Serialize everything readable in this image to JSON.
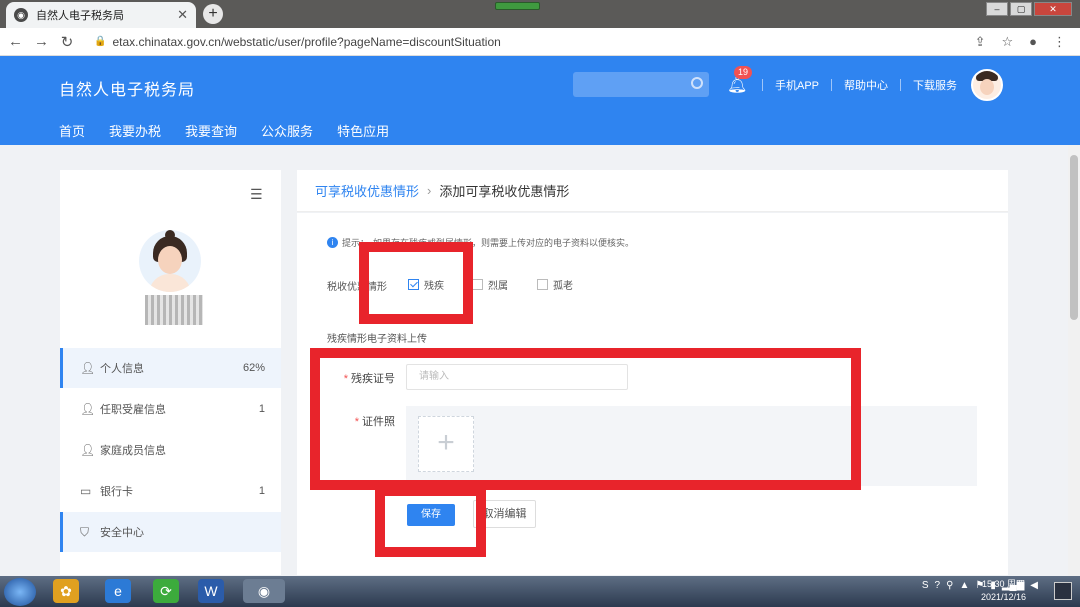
{
  "browser": {
    "tab_title": "自然人电子税务局",
    "url": "etax.chinatax.gov.cn/webstatic/user/profile?pageName=discountSituation"
  },
  "header": {
    "brand": "自然人电子税务局",
    "nav": [
      "首页",
      "我要办税",
      "我要查询",
      "公众服务",
      "特色应用"
    ],
    "notification_count": "19",
    "links": [
      "手机APP",
      "帮助中心",
      "下载服务"
    ]
  },
  "sidebar": {
    "items": [
      {
        "label": "个人信息",
        "count": "62%",
        "icon": "user-icon"
      },
      {
        "label": "任职受雇信息",
        "count": "1",
        "icon": "user-job-icon"
      },
      {
        "label": "家庭成员信息",
        "count": "",
        "icon": "family-icon"
      },
      {
        "label": "银行卡",
        "count": "1",
        "icon": "card-icon"
      },
      {
        "label": "安全中心",
        "count": "",
        "icon": "shield-icon"
      }
    ]
  },
  "breadcrumb": {
    "parent": "可享税收优惠情形",
    "current": "添加可享税收优惠情形"
  },
  "form": {
    "tip_prefix": "提示：",
    "tip": "如果存在残疾或烈属情形，则需要上传对应的电子资料以便核实。",
    "situation_label": "税收优惠情形",
    "options": [
      {
        "label": "残疾",
        "checked": true
      },
      {
        "label": "烈属",
        "checked": false
      },
      {
        "label": "孤老",
        "checked": false
      }
    ],
    "section_title": "残疾情形电子资料上传",
    "cert_number_label": "残疾证号",
    "cert_number_placeholder": "请输入",
    "cert_photo_label": "证件照",
    "save_label": "保存",
    "cancel_label": "取消编辑"
  },
  "taskbar": {
    "time": "15:30 周四",
    "date": "2021/12/16"
  },
  "colors": {
    "brand_blue": "#2f84f0",
    "annotation_red": "#e8242b"
  }
}
